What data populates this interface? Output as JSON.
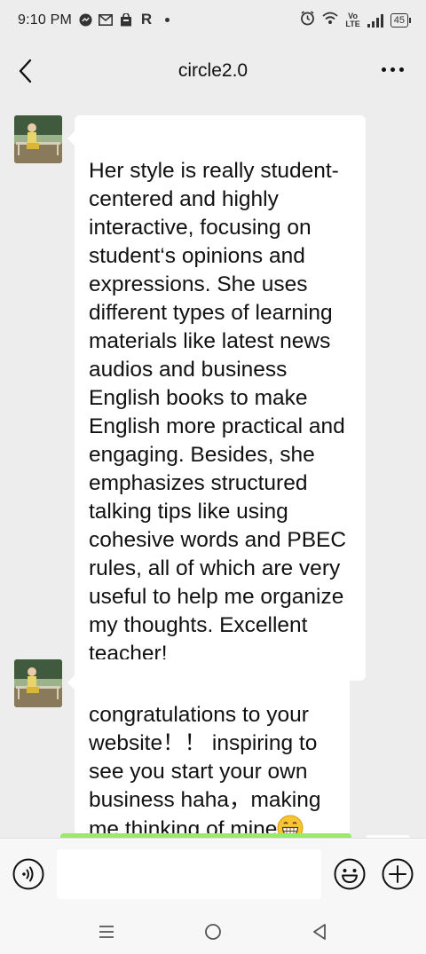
{
  "status_bar": {
    "time": "9:10 PM",
    "left_icons": [
      "messenger-icon",
      "gmail-icon",
      "shopping-bag-icon",
      "r-app-icon",
      "notification-dot-icon"
    ],
    "right_icons": [
      "alarm-icon",
      "wifi-icon",
      "volte-icon",
      "signal-icon",
      "battery-icon"
    ],
    "volte_line1": "Vo",
    "volte_line2": "LTE",
    "r_app_letter": "R",
    "battery": "45"
  },
  "header": {
    "title": "circle2.0",
    "back_icon": "chevron-left-icon",
    "more_icon": "more-dots-icon"
  },
  "messages": [
    {
      "sender": "contact",
      "text": "Her style is really student-\ncentered and highly\ninteractive, focusing on\nstudent‘s opinions and\nexpressions. She uses\ndifferent types of learning\nmaterials like latest news\naudios and business\nEnglish books to make\nEnglish more practical and\nengaging. Besides, she\nemphasizes structured\ntalking tips like using\ncohesive words and PBEC\nrules, all of which are very\nuseful to help me organize\nmy thoughts. Excellent\nteacher!"
    },
    {
      "sender": "contact",
      "text": "congratulations to your\nwebsite！！ inspiring to\nsee you start your own\nbusiness haha，making\nme thinking of mine",
      "emoji": "grinning-face-icon"
    }
  ],
  "input_bar": {
    "value": "",
    "voice_icon": "voice-icon",
    "emoji_icon": "emoji-icon",
    "plus_icon": "plus-icon"
  },
  "nav_bar": {
    "icons": [
      "menu-icon",
      "home-icon",
      "back-triangle-icon"
    ]
  },
  "colors": {
    "background": "#ededed",
    "bubble_incoming": "#ffffff",
    "bubble_outgoing": "#95ec69",
    "text": "#111111"
  }
}
